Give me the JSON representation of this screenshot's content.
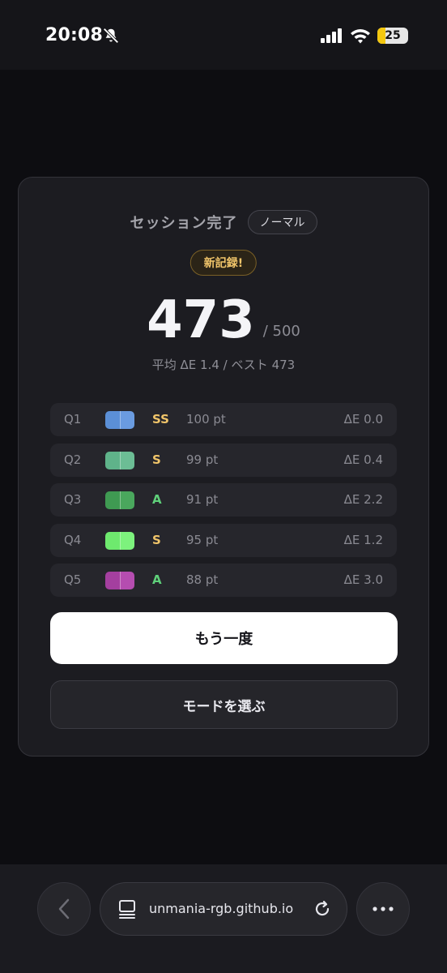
{
  "status_bar": {
    "time": "20:08",
    "battery": "25",
    "icons": [
      "bell-slash-icon",
      "signal-icon",
      "wifi-icon",
      "battery-icon"
    ]
  },
  "result": {
    "title": "セッション完了",
    "mode": "ノーマル",
    "badge": "新記録!",
    "score": "473",
    "score_max": "/ 500",
    "stats": "平均 ΔE 1.4 / ベスト 473",
    "rows": [
      {
        "q": "Q1",
        "colors": [
          "#5b8fd6",
          "#6a9be0"
        ],
        "grade": "SS",
        "grade_color": "#f1c56a",
        "points": "100 pt",
        "delta": "ΔE 0.0"
      },
      {
        "q": "Q2",
        "colors": [
          "#5fb38a",
          "#6cbd95"
        ],
        "grade": "S",
        "grade_color": "#f1c56a",
        "points": "99 pt",
        "delta": "ΔE 0.4"
      },
      {
        "q": "Q3",
        "colors": [
          "#3f9a52",
          "#4aa75d"
        ],
        "grade": "A",
        "grade_color": "#5fd07a",
        "points": "91 pt",
        "delta": "ΔE 2.2"
      },
      {
        "q": "Q4",
        "colors": [
          "#6ee96e",
          "#7df27d"
        ],
        "grade": "S",
        "grade_color": "#f1c56a",
        "points": "95 pt",
        "delta": "ΔE 1.2"
      },
      {
        "q": "Q5",
        "colors": [
          "#a43f9f",
          "#b54db0"
        ],
        "grade": "A",
        "grade_color": "#5fd07a",
        "points": "88 pt",
        "delta": "ΔE 3.0"
      }
    ],
    "retry_label": "もう一度",
    "choose_mode_label": "モードを選ぶ"
  },
  "browser": {
    "url": "unmania-rgb.github.io",
    "icons": [
      "back-icon",
      "tabs-icon",
      "reload-icon",
      "more-icon"
    ]
  }
}
